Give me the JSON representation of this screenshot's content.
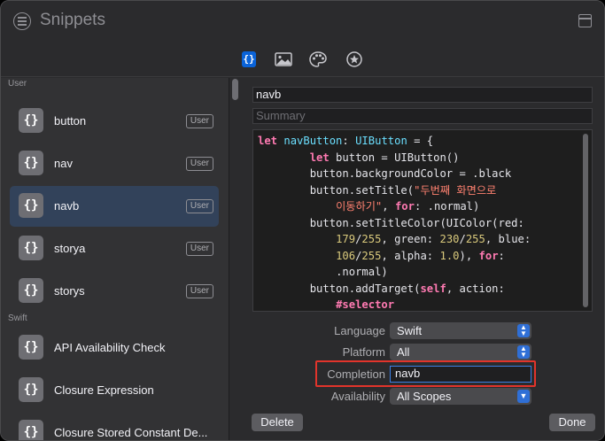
{
  "window": {
    "title": "Snippets"
  },
  "toolbar": {
    "tabs": [
      {
        "icon": "braces-icon",
        "glyph": "{}",
        "selected": true
      },
      {
        "icon": "image-icon",
        "glyph": "🖼"
      },
      {
        "icon": "palette-icon",
        "glyph": "🎨"
      },
      {
        "icon": "star-circle-icon",
        "glyph": "★"
      }
    ]
  },
  "sidebar": {
    "sections": [
      {
        "header": "User",
        "items": [
          {
            "glyph": "{}",
            "label": "button",
            "badge": "User"
          },
          {
            "glyph": "{}",
            "label": "nav",
            "badge": "User"
          },
          {
            "glyph": "{}",
            "label": "navb",
            "badge": "User",
            "selected": true
          },
          {
            "glyph": "{}",
            "label": "storya",
            "badge": "User"
          },
          {
            "glyph": "{}",
            "label": "storys",
            "badge": "User"
          }
        ]
      },
      {
        "header": "Swift",
        "items": [
          {
            "glyph": "{}",
            "label": "API Availability Check"
          },
          {
            "glyph": "{}",
            "label": "Closure Expression"
          },
          {
            "glyph": "{}",
            "label": "Closure Stored Constant De..."
          }
        ]
      }
    ]
  },
  "detail": {
    "title_value": "navb",
    "summary_placeholder": "Summary",
    "code": {
      "l1_kw": "let",
      "l1_name": "navButton",
      "l1_sep": ":",
      "l1_type": "UIButton",
      "l1_rest": " = {",
      "l2_kw": "let",
      "l2_rest": " button = UIButton()",
      "l3": "button.backgroundColor = .black",
      "l4_pre": "button.setTitle(",
      "l4_str": "\"두번째 화면으로",
      "l5_str": "이동하기\"",
      "l5_mid": ", ",
      "l5_kw": "for",
      "l5_rest": ": .normal)",
      "l6": "button.setTitleColor(UIColor(red:",
      "l7_n1": "179",
      "l7_s1": "/",
      "l7_n2": "255",
      "l7_s2": ", green: ",
      "l7_n3": "230",
      "l7_s3": "/",
      "l7_n4": "255",
      "l7_s4": ", blue:",
      "l8_n1": "106",
      "l8_s1": "/",
      "l8_n2": "255",
      "l8_s2": ", alpha: ",
      "l8_n3": "1.0",
      "l8_s3": "), ",
      "l8_kw": "for",
      "l8_s4": ":",
      "l9": ".normal)",
      "l10_pre": "button.addTarget(",
      "l10_kw": "self",
      "l10_rest": ", action:",
      "l11_kw": "#selector"
    },
    "form": {
      "language_label": "Language",
      "language_value": "Swift",
      "platform_label": "Platform",
      "platform_value": "All",
      "completion_label": "Completion",
      "completion_value": "navb",
      "availability_label": "Availability",
      "availability_value": "All Scopes"
    },
    "delete_label": "Delete",
    "done_label": "Done"
  },
  "colors": {
    "accent": "#0a63d8",
    "selection": "#32425a",
    "keyword": "#ff7ab2",
    "type": "#6bdfff",
    "string": "#ff8170",
    "number": "#d9c97c",
    "highlight_box": "#e2342b"
  }
}
